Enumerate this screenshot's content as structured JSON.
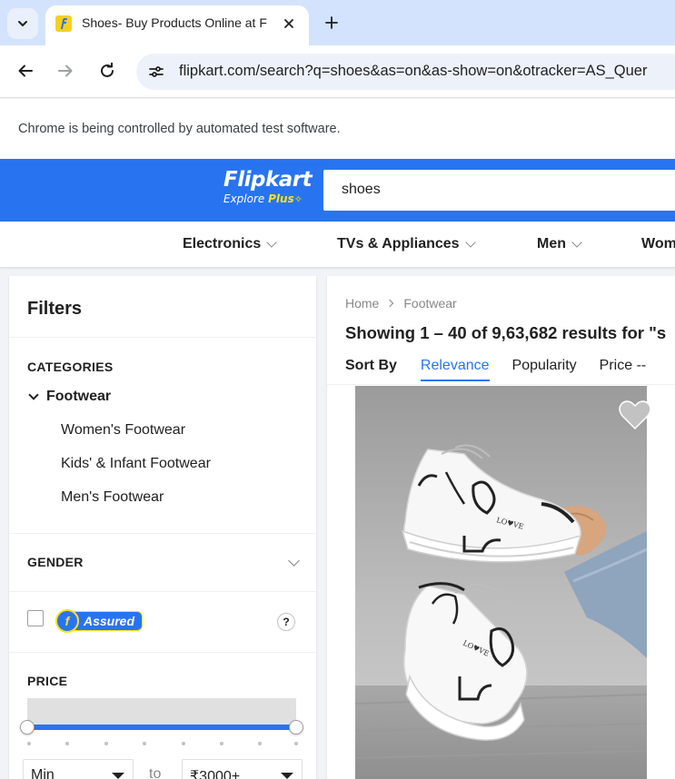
{
  "browser": {
    "tab_title": "Shoes- Buy Products Online at F",
    "url": "flipkart.com/search?q=shoes&as=on&as-show=on&otracker=AS_Quer",
    "automation_notice": "Chrome is being controlled by automated test software.",
    "icons": [
      "tab-search-icon",
      "flipkart-favicon",
      "close-icon",
      "plus-icon",
      "back-arrow-icon",
      "forward-arrow-icon",
      "reload-icon",
      "site-info-icon"
    ]
  },
  "header": {
    "logo_text": "Flipkart",
    "tagline_prefix": "Explore",
    "tagline_plus": "Plus",
    "search_value": "shoes",
    "brand_color": "#2874f0",
    "accent_color": "#ffe11b"
  },
  "category_nav": {
    "items": [
      {
        "label": "Electronics"
      },
      {
        "label": "TVs & Appliances"
      },
      {
        "label": "Men"
      },
      {
        "label": "Wom"
      }
    ]
  },
  "filters": {
    "title": "Filters",
    "categories_heading": "CATEGORIES",
    "parent_category": "Footwear",
    "sub_categories": [
      "Women's Footwear",
      "Kids' & Infant Footwear",
      "Men's Footwear"
    ],
    "gender_heading": "GENDER",
    "assured_badge_letter": "f",
    "assured_label": "Assured",
    "help_label": "?",
    "price_heading": "PRICE",
    "price_min": "Min",
    "price_to": "to",
    "price_max": "₹3000+"
  },
  "results": {
    "breadcrumb": [
      "Home",
      "Footwear"
    ],
    "showing_text": "Showing 1 – 40 of 9,63,682 results for \"s",
    "sort_label": "Sort By",
    "sort_options": [
      "Relevance",
      "Popularity",
      "Price --"
    ],
    "active_sort": "Relevance"
  }
}
